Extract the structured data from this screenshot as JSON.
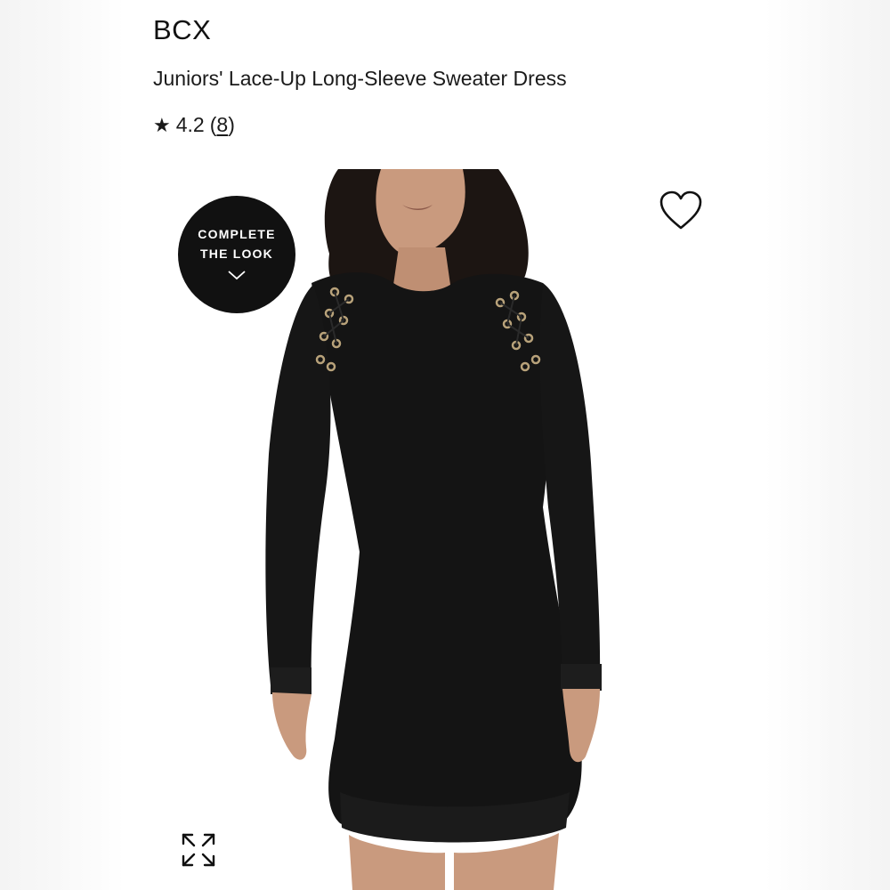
{
  "product": {
    "brand": "BCX",
    "title": "Juniors' Lace-Up Long-Sleeve Sweater Dress",
    "rating": {
      "star": "★",
      "value": "4.2",
      "open_paren": "(",
      "count": "8",
      "close_paren": ")"
    }
  },
  "image": {
    "badge": {
      "line1": "COMPLETE",
      "line2": "THE LOOK"
    },
    "icons": [
      "heart-icon",
      "chevron-down-icon",
      "expand-icon"
    ]
  },
  "colors": {
    "text": "#111111",
    "badge_bg": "#111111",
    "badge_text": "#ffffff",
    "dress": "#141414",
    "skin": "#c99a7e",
    "hair": "#1c1512",
    "eyelet": "#b8a27a"
  }
}
